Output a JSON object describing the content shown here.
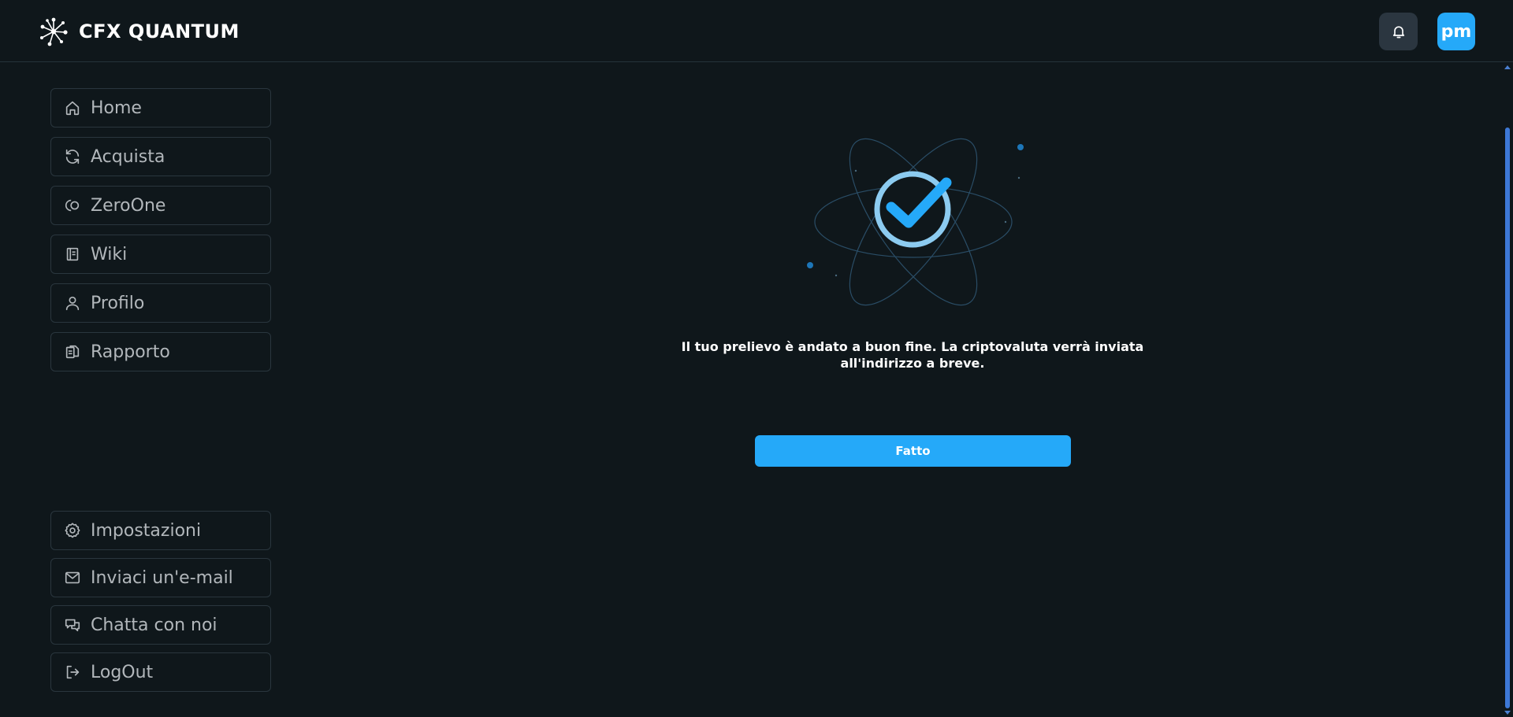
{
  "app": {
    "brand_name": "CFX QUANTUM",
    "avatar_initials": "pm"
  },
  "colors": {
    "background": "#0f171b",
    "accent": "#25a9f9",
    "border": "#2a363e",
    "nav_text": "#b2b7bb"
  },
  "sidebar": {
    "top_items": [
      {
        "label": "Home",
        "icon": "home-icon"
      },
      {
        "label": "Acquista",
        "icon": "refresh-icon"
      },
      {
        "label": "ZeroOne",
        "icon": "zeroone-icon"
      },
      {
        "label": "Wiki",
        "icon": "book-icon"
      },
      {
        "label": "Profilo",
        "icon": "user-icon"
      },
      {
        "label": "Rapporto",
        "icon": "report-icon"
      }
    ],
    "bottom_items": [
      {
        "label": "Impostazioni",
        "icon": "gear-icon"
      },
      {
        "label": "Inviaci un'e-mail",
        "icon": "mail-icon"
      },
      {
        "label": "Chatta con noi",
        "icon": "chat-icon"
      },
      {
        "label": "LogOut",
        "icon": "logout-icon"
      }
    ]
  },
  "main": {
    "success_icon": "check-circle-icon",
    "message_line1": "Il tuo prelievo è andato a buon fine. La criptovaluta verrà inviata",
    "message_line2": "all'indirizzo a breve.",
    "done_label": "Fatto"
  }
}
